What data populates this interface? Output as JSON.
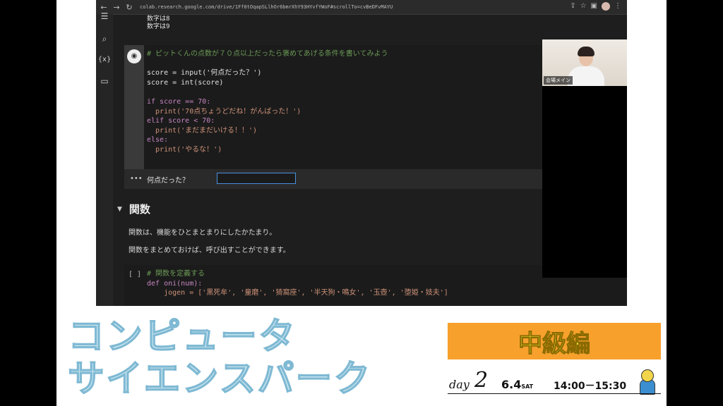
{
  "browser": {
    "url": "colab.research.google.com/drive/1Ff0tOqapSLlhOr6bmrXhY93HYvfYWoF#scrollTo=cvBeDFvMAYU",
    "nav": [
      "←",
      "→",
      "↻"
    ],
    "right_icons": [
      "⇪",
      "☆",
      "▣",
      "⋮"
    ]
  },
  "sidebar": {
    "icons": [
      "☰",
      "⌕",
      "{x}",
      "▭"
    ]
  },
  "prev_output": [
    "数字は8",
    "数字は9"
  ],
  "cell1": {
    "lines": [
      "# ピットくんの点数が７０点以上だったら褒めてあげる条件を書いてみよう",
      "",
      "score = input('何点だった？')",
      "score = int(score)",
      "",
      "if score == 70:",
      "  print('70点ちょうどだね！がんばった！')",
      "elif score < 70:",
      "  print('まだまだいける！！')",
      "else:",
      "  print('やるな！')"
    ],
    "run_icon": "◉"
  },
  "output": {
    "dots": "•••",
    "prompt": "何点だった？",
    "input_value": ""
  },
  "section": {
    "caret": "▼",
    "title": "関数"
  },
  "paragraphs": [
    "関数は、機能をひとまとまりにしたかたまり。",
    "関数をまとめておけば、呼び出すことができます。"
  ],
  "cell2": {
    "bracket": "[ ]",
    "lines": [
      "# 関数を定義する",
      "def oni(num):",
      "    jogen = ['黒死牟', '童磨', '猗窩座', '半天狗・鳴女', '玉壺', '堕姫・妓夫']"
    ]
  },
  "video": {
    "label": "会場メイン"
  },
  "banner": {
    "title_line1": "コンピュータ",
    "title_line2": "サイエンスパーク",
    "badge": "中級編",
    "day_word": "day",
    "day_num": "2",
    "date": "6.4",
    "weekday": "SAT",
    "time": "14:00－15:30"
  },
  "colors": {
    "badge_bg": "#f7a12c",
    "badge_text": "#f4ef3b",
    "title_fill": "#cde8f2",
    "input_border": "#4a90e2"
  }
}
